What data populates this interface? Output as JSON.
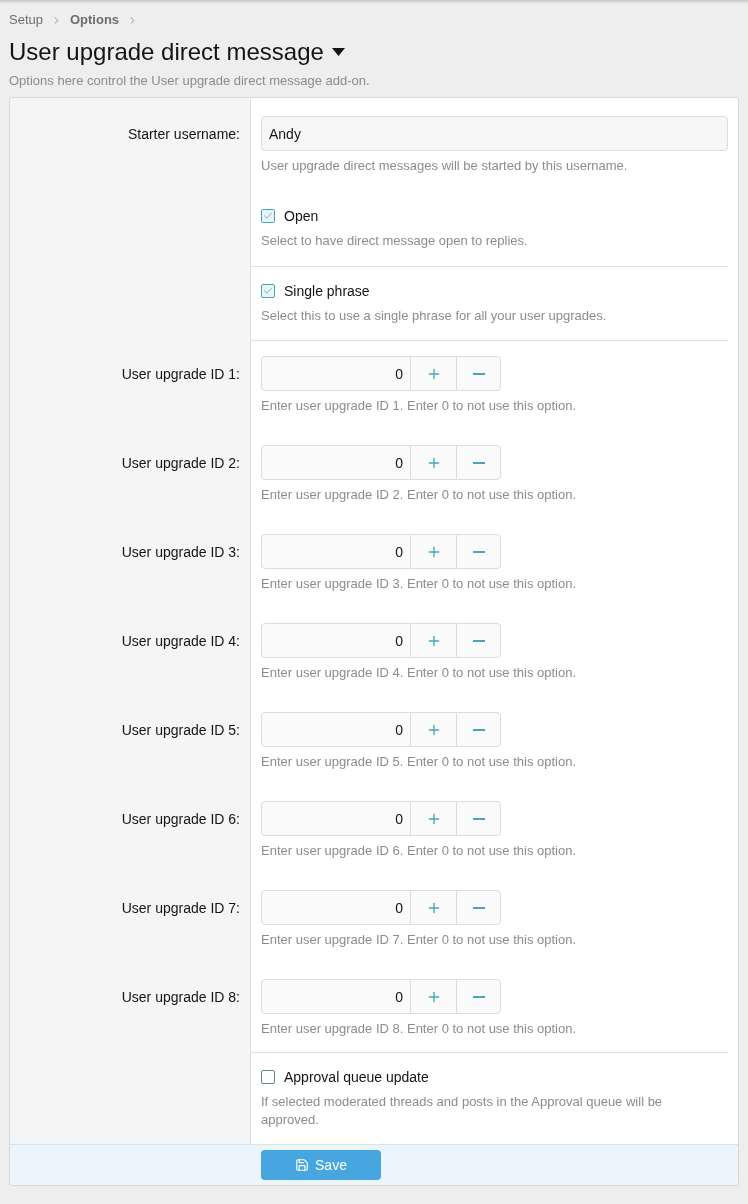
{
  "breadcrumb": [
    {
      "label": "Setup",
      "bold": false
    },
    {
      "label": "Options",
      "bold": true
    }
  ],
  "title": "User upgrade direct message",
  "description": "Options here control the User upgrade direct message add-on.",
  "groups": [
    {
      "items": [
        {
          "kind": "text",
          "label": "Starter username:",
          "value": "Andy",
          "hint": "User upgrade direct messages will be started by this username."
        },
        {
          "kind": "checkbox",
          "label": "Open",
          "checked": true,
          "hint": "Select to have direct message open to replies."
        }
      ]
    },
    {
      "items": [
        {
          "kind": "checkbox",
          "label": "Single phrase",
          "checked": true,
          "hint": "Select this to use a single phrase for all your user upgrades."
        }
      ]
    },
    {
      "items": [
        {
          "kind": "number",
          "label": "User upgrade ID 1:",
          "value": "0",
          "hint": "Enter user upgrade ID 1. Enter 0 to not use this option."
        },
        {
          "kind": "number",
          "label": "User upgrade ID 2:",
          "value": "0",
          "hint": "Enter user upgrade ID 2. Enter 0 to not use this option."
        },
        {
          "kind": "number",
          "label": "User upgrade ID 3:",
          "value": "0",
          "hint": "Enter user upgrade ID 3. Enter 0 to not use this option."
        },
        {
          "kind": "number",
          "label": "User upgrade ID 4:",
          "value": "0",
          "hint": "Enter user upgrade ID 4. Enter 0 to not use this option."
        },
        {
          "kind": "number",
          "label": "User upgrade ID 5:",
          "value": "0",
          "hint": "Enter user upgrade ID 5. Enter 0 to not use this option."
        },
        {
          "kind": "number",
          "label": "User upgrade ID 6:",
          "value": "0",
          "hint": "Enter user upgrade ID 6. Enter 0 to not use this option."
        },
        {
          "kind": "number",
          "label": "User upgrade ID 7:",
          "value": "0",
          "hint": "Enter user upgrade ID 7. Enter 0 to not use this option."
        },
        {
          "kind": "number",
          "label": "User upgrade ID 8:",
          "value": "0",
          "hint": "Enter user upgrade ID 8. Enter 0 to not use this option."
        }
      ]
    },
    {
      "items": [
        {
          "kind": "checkbox",
          "label": "Approval queue update",
          "checked": false,
          "hint": "If selected moderated threads and posts in the Approval queue will be approved."
        }
      ]
    }
  ],
  "save_button": {
    "label": "Save"
  }
}
